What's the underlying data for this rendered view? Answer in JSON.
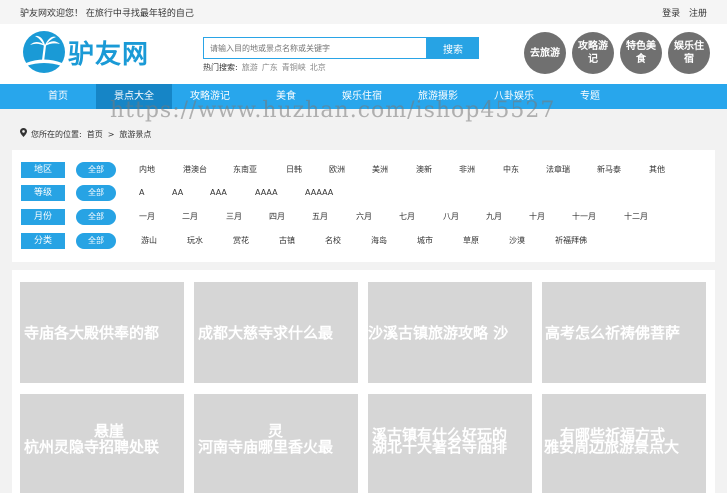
{
  "topbar": {
    "welcome": "驴友网欢迎您！ 在旅行中寻找最年轻的自己",
    "login": "登录",
    "register": "注册"
  },
  "logo": {
    "brand": "驴友网"
  },
  "search": {
    "placeholder": "请输入目的地或景点名称或关键字",
    "button": "搜索",
    "hot_label": "热门搜索:",
    "hot_keywords": [
      "旅游",
      "广东",
      "青铜峡",
      "北京"
    ]
  },
  "circles": [
    "去旅游",
    "攻略游记",
    "特色美食",
    "娱乐住宿"
  ],
  "nav": {
    "items": [
      "首页",
      "景点大全",
      "攻略游记",
      "美食",
      "娱乐住宿",
      "旅游摄影",
      "八卦娱乐",
      "专题"
    ],
    "active_index": 1
  },
  "watermark": "https://www.huzhan.com/ishop45527",
  "breadcrumb": {
    "prefix": "您所在的位置:",
    "home": "首页",
    "sep": ">",
    "current": "旅游景点"
  },
  "filters": [
    {
      "label": "地区",
      "all": "全部",
      "options": [
        "内地",
        "港澳台",
        "东南亚",
        "日韩",
        "欧洲",
        "美洲",
        "澳新",
        "非洲",
        "中东",
        "法章瑞",
        "新马泰",
        "其他"
      ]
    },
    {
      "label": "等级",
      "all": "全部",
      "options": [
        "A",
        "AA",
        "AAA",
        "AAAA",
        "AAAAA"
      ]
    },
    {
      "label": "月份",
      "all": "全部",
      "options": [
        "一月",
        "二月",
        "三月",
        "四月",
        "五月",
        "六月",
        "七月",
        "八月",
        "九月",
        "十月",
        "十一月",
        "十二月"
      ]
    },
    {
      "label": "分类",
      "all": "全部",
      "options": [
        "游山",
        "玩水",
        "赏花",
        "古镇",
        "名校",
        "海岛",
        "城市",
        "草原",
        "沙漠",
        "祈福拜佛"
      ]
    }
  ],
  "cards_row1": [
    "寺庙各大殿供奉的都",
    "成都大慈寺求什么最",
    "沙溪古镇旅游攻略 沙",
    "高考怎么祈祷佛菩萨"
  ],
  "cards_row2": [
    "杭州灵隐寺招聘处联",
    "河南寺庙哪里香火最",
    "湖北十大著名寺庙排",
    "雅安周边旅游景点大"
  ],
  "cards_row2_overlap": [
    "悬崖",
    "灵",
    "溪古镇有什么好玩的",
    "有哪些祈福方式"
  ],
  "colors": {
    "accent": "#27a3e4",
    "nav_active": "#1685c6",
    "circle": "#707070",
    "card_placeholder": "#d6d6d6"
  }
}
